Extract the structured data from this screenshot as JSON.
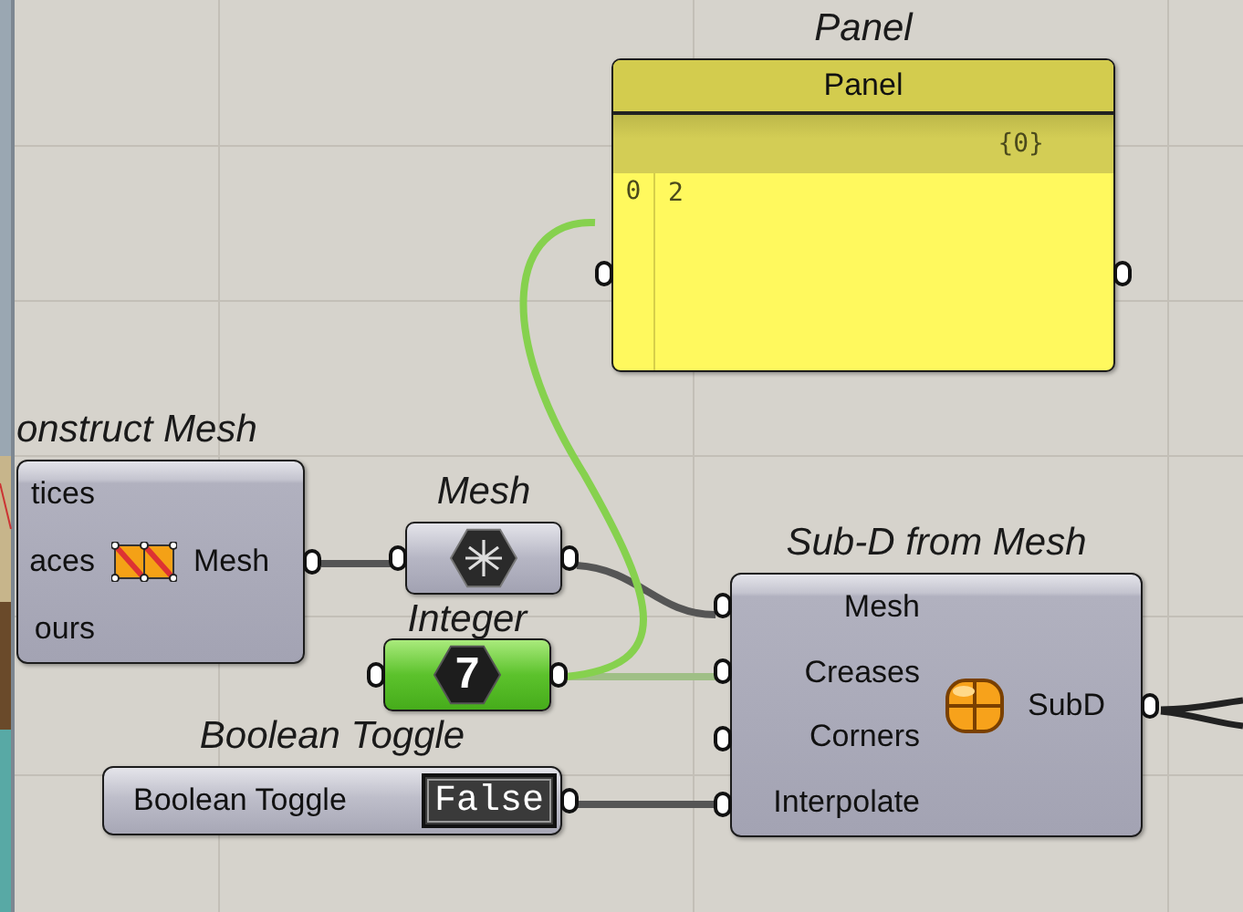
{
  "nodes": [
    {
      "kind": "component",
      "title": "onstruct Mesh",
      "inputs": [
        "tices",
        "aces",
        "ours"
      ],
      "outputs": [
        "Mesh"
      ]
    },
    {
      "kind": "param",
      "title": "Mesh"
    },
    {
      "kind": "integer",
      "title": "Integer",
      "value": "7"
    },
    {
      "kind": "panel",
      "title": "Panel",
      "header": "Panel",
      "path": "{0}",
      "rows": [
        {
          "index": "0",
          "value": "2"
        }
      ]
    },
    {
      "kind": "toggle",
      "title": "Boolean Toggle",
      "label": "Boolean Toggle",
      "value": "False"
    },
    {
      "kind": "component",
      "title": "Sub-D from Mesh",
      "inputs": [
        "Mesh",
        "Creases",
        "Corners",
        "Interpolate"
      ],
      "outputs": [
        "SubD"
      ]
    }
  ]
}
